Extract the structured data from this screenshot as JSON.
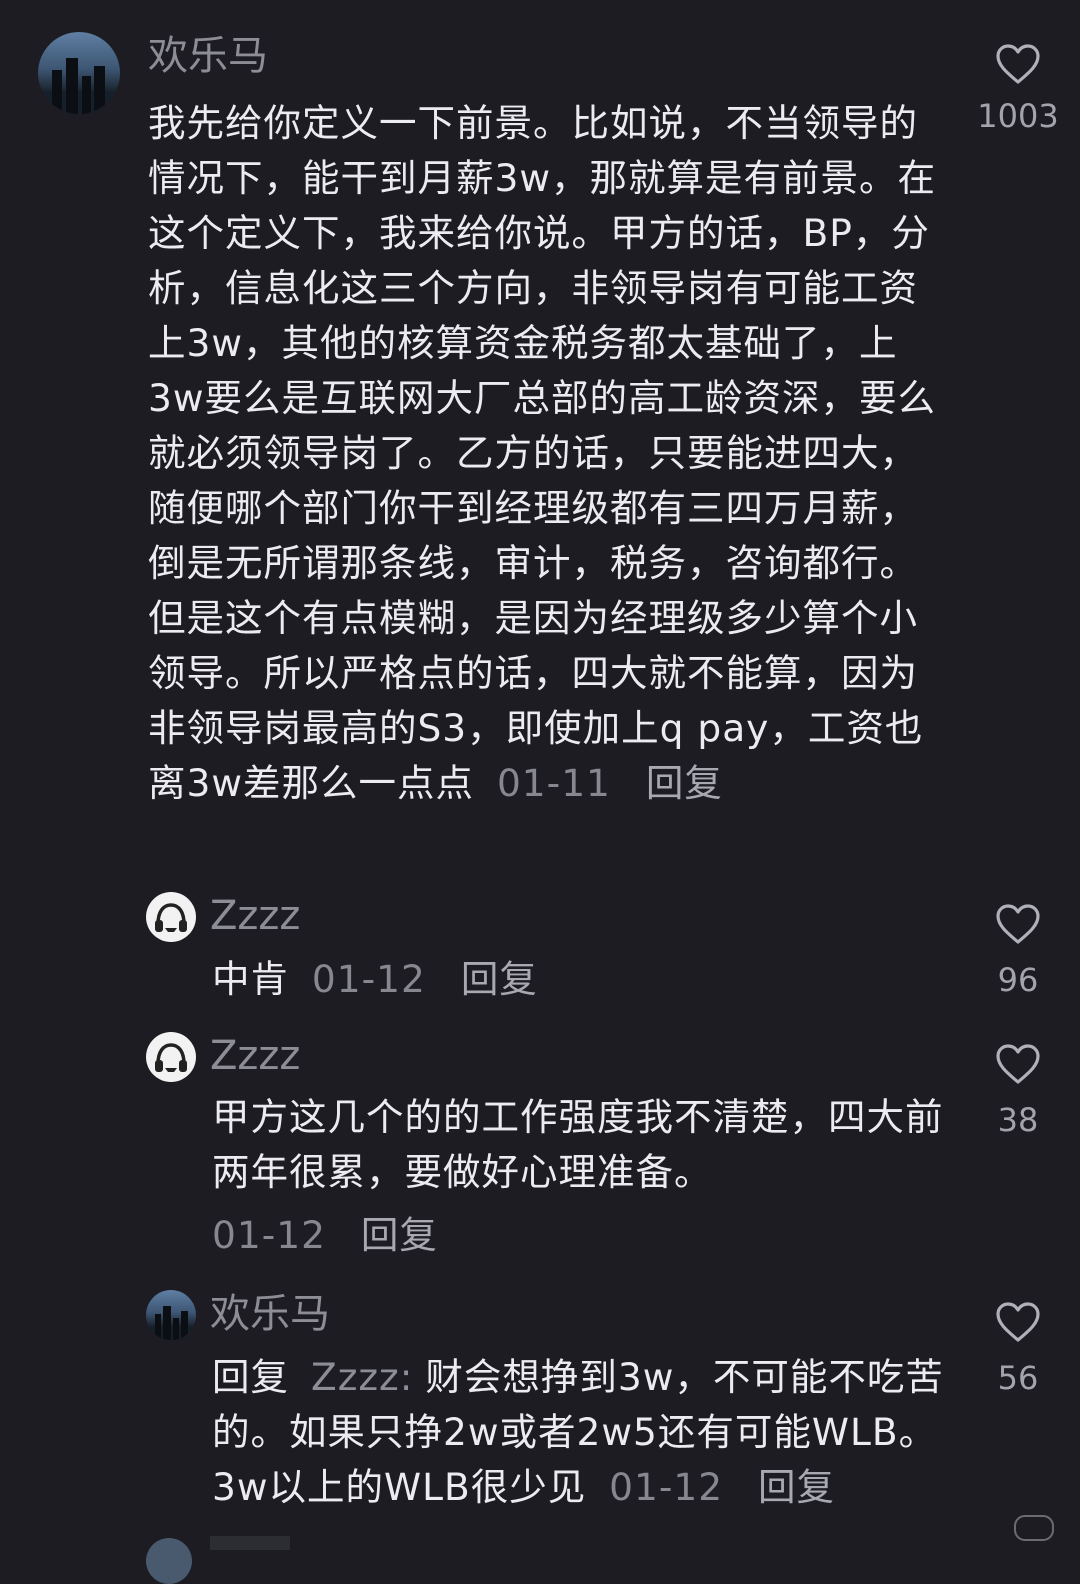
{
  "comments": [
    {
      "name": "欢乐马",
      "text": "我先给你定义一下前景。比如说，不当领导的情况下，能干到月薪3w，那就算是有前景。在这个定义下，我来给你说。甲方的话，BP，分析，信息化这三个方向，非领导岗有可能工资上3w，其他的核算资金税务都太基础了，上3w要么是互联网大厂总部的高工龄资深，要么就必须领导岗了。乙方的话，只要能进四大，随便哪个部门你干到经理级都有三四万月薪，倒是无所谓那条线，审计，税务，咨询都行。但是这个有点模糊，是因为经理级多少算个小领导。所以严格点的话，四大就不能算，因为非领导岗最高的S3，即使加上q pay，工资也离3w差那么一点点",
      "date": "01-11",
      "reply_label": "回复",
      "likes": "1003"
    },
    {
      "name": "Zzzz",
      "text": "中肯",
      "date": "01-12",
      "reply_label": "回复",
      "likes": "96"
    },
    {
      "name": "Zzzz",
      "text": "甲方这几个的的工作强度我不清楚，四大前两年很累，要做好心理准备。",
      "date": "01-12",
      "reply_label": "回复",
      "likes": "38"
    },
    {
      "name": "欢乐马",
      "reply_prefix": "回复",
      "mention": "Zzzz:",
      "text": "财会想挣到3w，不可能不吃苦的。如果只挣2w或者2w5还有可能WLB。3w以上的WLB很少见",
      "date": "01-12",
      "reply_label": "回复",
      "likes": "56"
    }
  ]
}
